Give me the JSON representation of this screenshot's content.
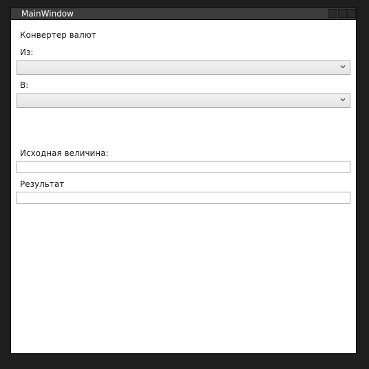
{
  "window": {
    "title": "MainWindow"
  },
  "converter": {
    "header": "Конвертер валют",
    "from_label": "Из:",
    "from_value": "",
    "to_label": "В:",
    "to_value": "",
    "source_label": "Исходная величина:",
    "source_value": "",
    "result_label": "Результат",
    "result_value": ""
  },
  "icons": {
    "dropdown": "chevron-down-icon"
  },
  "colors": {
    "desktop": "#1e1e1e",
    "titlebar": "#3c3c3c",
    "window_bg": "#ffffff"
  }
}
